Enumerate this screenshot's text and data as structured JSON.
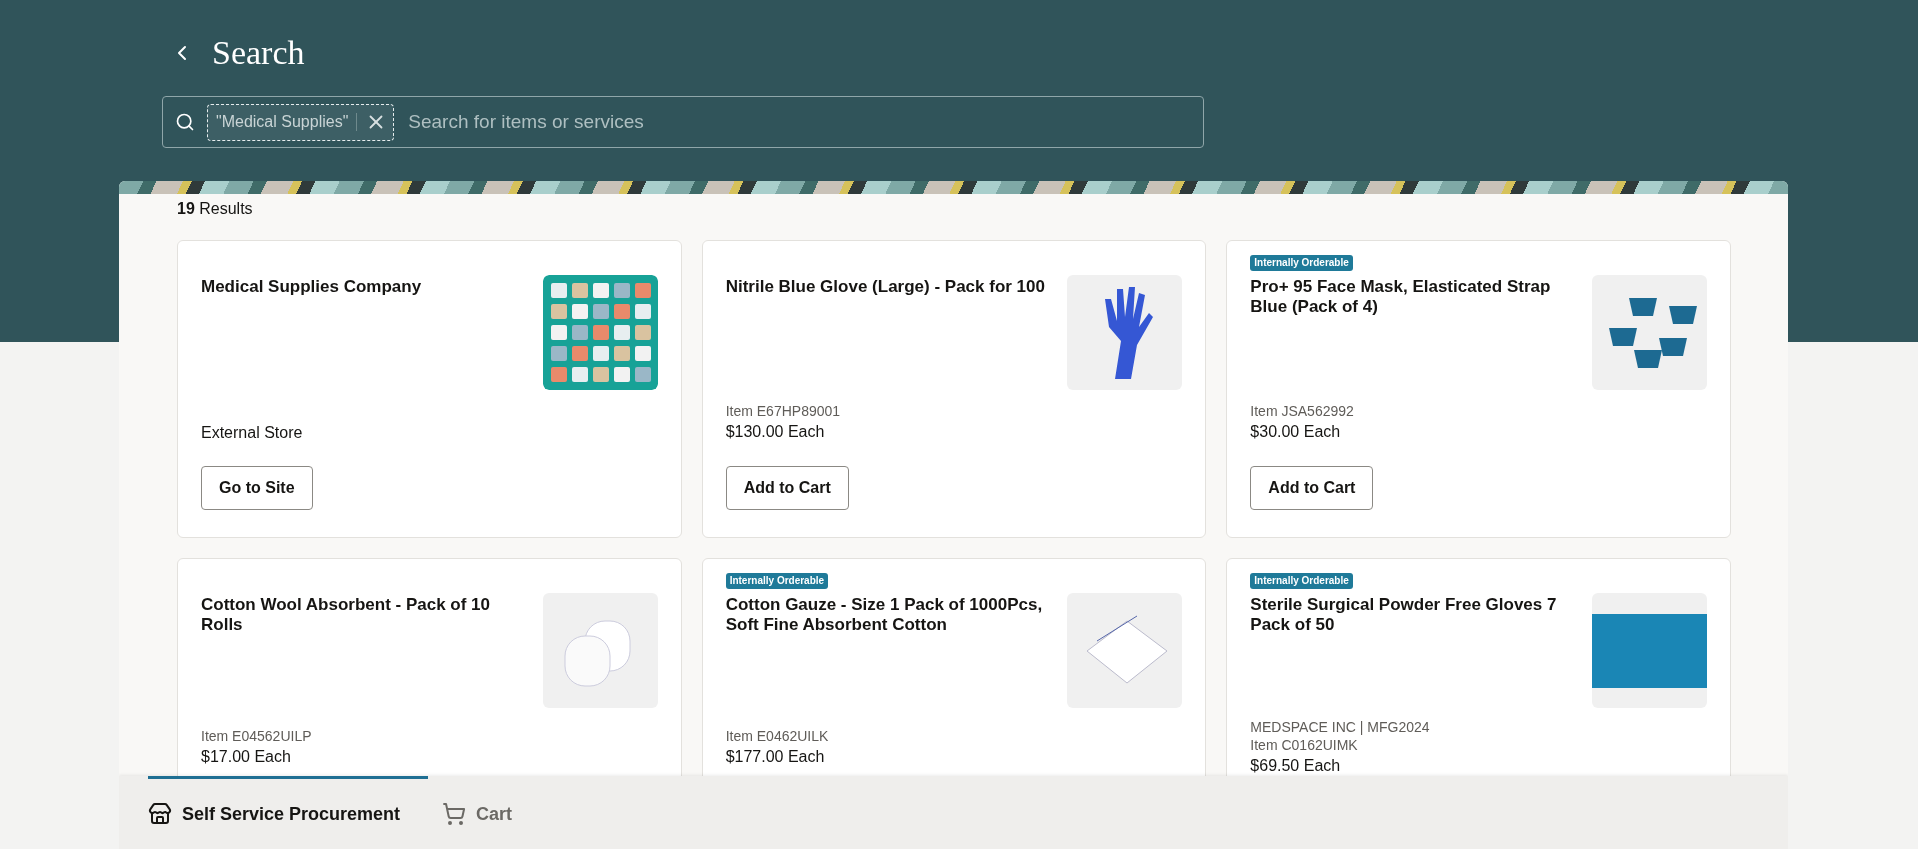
{
  "header": {
    "title": "Search"
  },
  "search": {
    "chip": "\"Medical Supplies\"",
    "placeholder": "Search for items or services"
  },
  "results": {
    "count": "19",
    "label": "Results"
  },
  "cards": [
    {
      "kind": "store",
      "title": "Medical Supplies Company",
      "meta": [
        "External Store"
      ],
      "button": "Go to Site"
    },
    {
      "kind": "item",
      "title": "Nitrile Blue Glove (Large) - Pack for 100",
      "meta": [
        "Item E67HP89001"
      ],
      "price": "$130.00 Each",
      "button": "Add to Cart"
    },
    {
      "kind": "item",
      "badge": "Internally Orderable",
      "title": "Pro+ 95 Face Mask, Elasticated Strap Blue (Pack of 4)",
      "meta": [
        "Item JSA562992"
      ],
      "price": "$30.00 Each",
      "button": "Add to Cart"
    },
    {
      "kind": "item",
      "title": "Cotton Wool Absorbent - Pack of 10 Rolls",
      "meta": [
        "Item E04562UILP"
      ],
      "price": "$17.00 Each"
    },
    {
      "kind": "item",
      "badge": "Internally Orderable",
      "title": "Cotton Gauze - Size 1 Pack of 1000Pcs, Soft Fine Absorbent Cotton",
      "meta": [
        "Item E0462UILK"
      ],
      "price": "$177.00 Each"
    },
    {
      "kind": "item",
      "badge": "Internally Orderable",
      "title": "Sterile Surgical Powder Free Gloves 7 Pack of 50",
      "meta": [
        "MEDSPACE INC | MFG2024",
        "Item C0162UIMK"
      ],
      "price": "$69.50 Each"
    }
  ],
  "bottom_tabs": [
    {
      "label": "Self Service Procurement",
      "kind": "store",
      "selected": true
    },
    {
      "label": "Cart",
      "kind": "cart",
      "selected": false
    }
  ]
}
